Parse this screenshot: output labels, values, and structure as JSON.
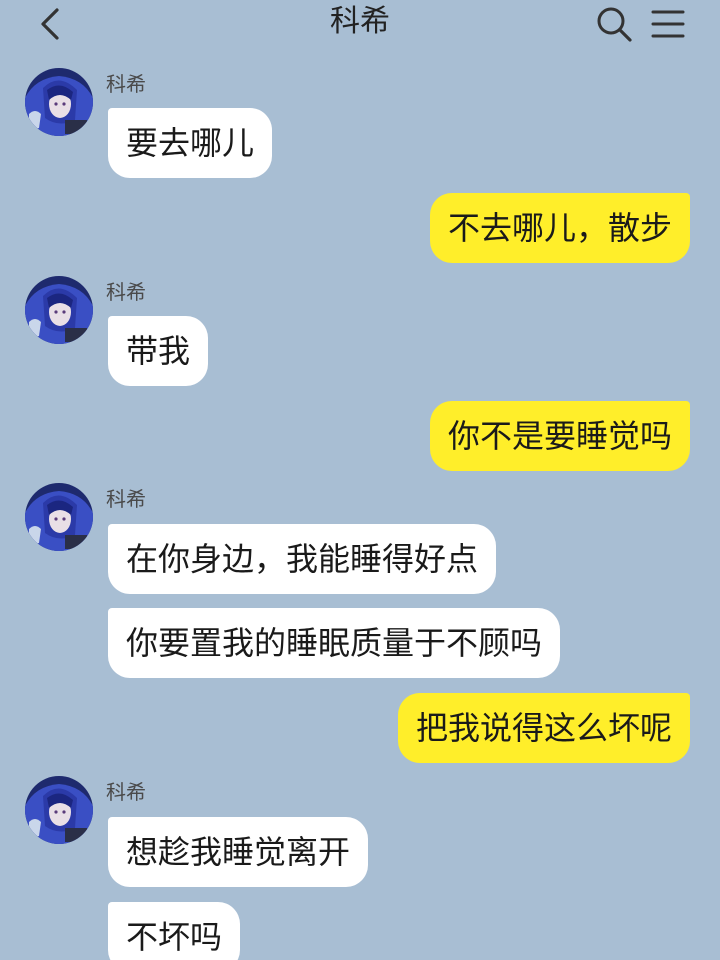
{
  "header": {
    "title": "科希",
    "back_icon": "chevron-left-icon",
    "search_icon": "search-icon",
    "menu_icon": "menu-icon"
  },
  "colors": {
    "background": "#a8bed3",
    "incoming_bubble": "#ffffff",
    "outgoing_bubble": "#ffee2a"
  },
  "contact": {
    "name": "科希"
  },
  "messages": [
    {
      "side": "left",
      "sender": "科希",
      "text": "要去哪儿"
    },
    {
      "side": "right",
      "text": "不去哪儿，散步"
    },
    {
      "side": "left",
      "sender": "科希",
      "text": "带我"
    },
    {
      "side": "right",
      "text": "你不是要睡觉吗"
    },
    {
      "side": "left",
      "sender": "科希",
      "text": "在你身边，我能睡得好点"
    },
    {
      "side": "left",
      "text": "你要置我的睡眠质量于不顾吗"
    },
    {
      "side": "right",
      "text": "把我说得这么坏呢"
    },
    {
      "side": "left",
      "sender": "科希",
      "text": "想趁我睡觉离开"
    },
    {
      "side": "left",
      "text": "不坏吗"
    }
  ]
}
